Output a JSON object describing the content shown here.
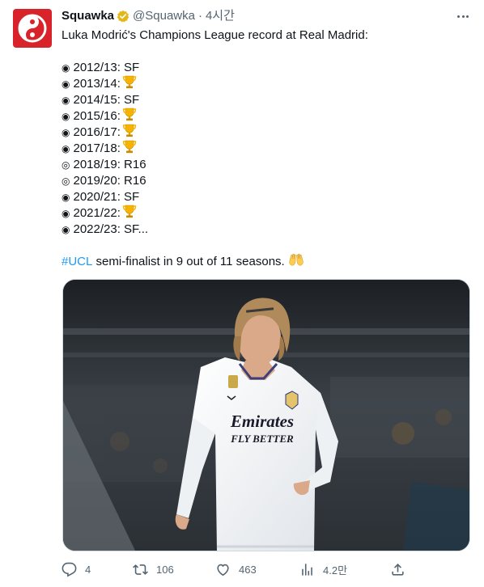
{
  "tweet": {
    "author": {
      "name": "Squawka",
      "handle": "@Squawka",
      "separator": "·",
      "timestamp": "4시간",
      "verified": true,
      "verified_badge_color": "#e2b719",
      "avatar_color": "#d8232a"
    },
    "intro": "Luka Modrić's Champions League record at Real Madrid:",
    "records": [
      {
        "bullet": "◉",
        "text": "2012/13: SF",
        "trophy": false
      },
      {
        "bullet": "◉",
        "text": "2013/14:",
        "trophy": true
      },
      {
        "bullet": "◉",
        "text": "2014/15: SF",
        "trophy": false
      },
      {
        "bullet": "◉",
        "text": "2015/16:",
        "trophy": true
      },
      {
        "bullet": "◉",
        "text": "2016/17:",
        "trophy": true
      },
      {
        "bullet": "◉",
        "text": "2017/18:",
        "trophy": true
      },
      {
        "bullet": "◎",
        "text": "2018/19: R16",
        "trophy": false
      },
      {
        "bullet": "◎",
        "text": "2019/20: R16",
        "trophy": false
      },
      {
        "bullet": "◉",
        "text": "2020/21: SF",
        "trophy": false
      },
      {
        "bullet": "◉",
        "text": "2021/22:",
        "trophy": true
      },
      {
        "bullet": "◉",
        "text": "2022/23: SF...",
        "trophy": false
      }
    ],
    "summary": {
      "hashtag": "#UCL",
      "text": " semi-finalist in 9 out of 11 seasons."
    },
    "media": {
      "shirt_sponsor_line1": "Emirates",
      "shirt_sponsor_line2": "FLY BETTER"
    },
    "actions": {
      "replies": "4",
      "retweets": "106",
      "likes": "463",
      "views": "4.2만"
    },
    "colors": {
      "link": "#1d9bf0",
      "muted": "#536471",
      "text": "#0f1419"
    }
  }
}
